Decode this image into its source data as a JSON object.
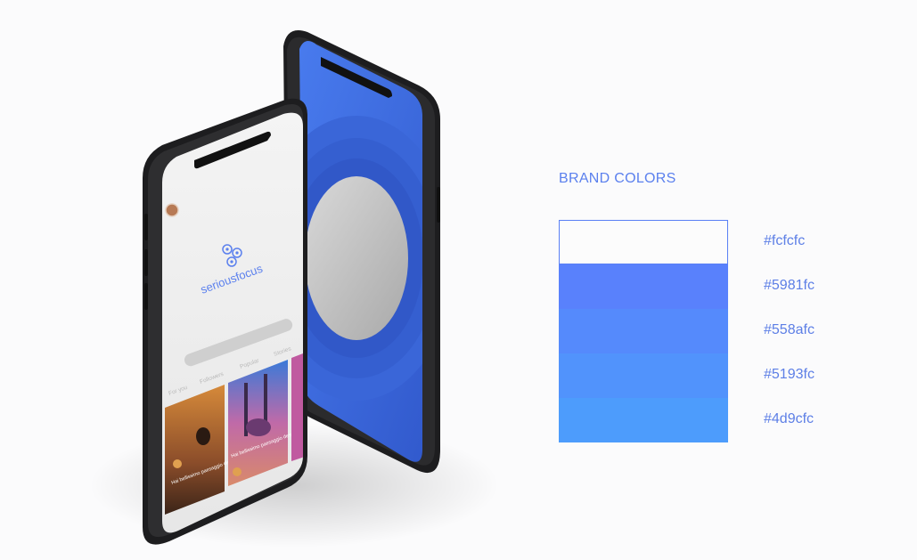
{
  "brand": {
    "title": "BRAND COLORS",
    "swatches": [
      {
        "hex": "#fcfcfc",
        "label": "#fcfcfc"
      },
      {
        "hex": "#5981fc",
        "label": "#5981fc"
      },
      {
        "hex": "#558afc",
        "label": "#558afc"
      },
      {
        "hex": "#5193fc",
        "label": "#5193fc"
      },
      {
        "hex": "#4d9cfc",
        "label": "#4d9cfc"
      }
    ]
  },
  "app": {
    "name": "seriousfocus",
    "tabs": [
      "For you",
      "Followers",
      "Popular",
      "Stories"
    ],
    "cards": [
      {
        "title": "Hai bellissimo paesaggio desertico"
      },
      {
        "title": "Hai bellissimo paesaggio desertico"
      }
    ]
  },
  "colors": {
    "accent": "#5b80ee",
    "phone_frame": "#1d1d1f",
    "back_screen": "#3d6ae0",
    "ring": "#2f58c8"
  }
}
